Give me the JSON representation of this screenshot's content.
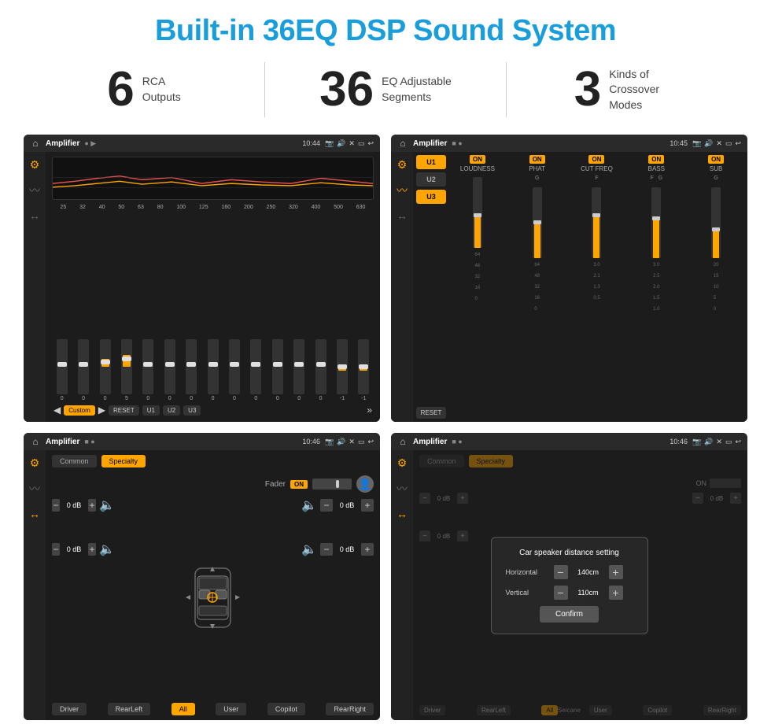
{
  "title": "Built-in 36EQ DSP Sound System",
  "stats": [
    {
      "number": "6",
      "text_line1": "RCA",
      "text_line2": "Outputs"
    },
    {
      "number": "36",
      "text_line1": "EQ Adjustable",
      "text_line2": "Segments"
    },
    {
      "number": "3",
      "text_line1": "Kinds of",
      "text_line2": "Crossover Modes"
    }
  ],
  "screens": [
    {
      "id": "screen1",
      "app_title": "Amplifier",
      "time": "10:44",
      "type": "eq",
      "freq_labels": [
        "25",
        "32",
        "40",
        "50",
        "63",
        "80",
        "100",
        "125",
        "160",
        "200",
        "250",
        "320",
        "400",
        "500",
        "630"
      ],
      "sliders": [
        {
          "pos": 50,
          "val": "0"
        },
        {
          "pos": 50,
          "val": "0"
        },
        {
          "pos": 45,
          "val": "0"
        },
        {
          "pos": 52,
          "val": "5"
        },
        {
          "pos": 50,
          "val": "0"
        },
        {
          "pos": 50,
          "val": "0"
        },
        {
          "pos": 50,
          "val": "0"
        },
        {
          "pos": 50,
          "val": "0"
        },
        {
          "pos": 50,
          "val": "0"
        },
        {
          "pos": 50,
          "val": "0"
        },
        {
          "pos": 50,
          "val": "0"
        },
        {
          "pos": 50,
          "val": "0"
        },
        {
          "pos": 50,
          "val": "0"
        },
        {
          "pos": 52,
          "val": "-1"
        },
        {
          "pos": 52,
          "val": "-1"
        }
      ],
      "preset_label": "Custom",
      "buttons": [
        "RESET",
        "U1",
        "U2",
        "U3"
      ]
    },
    {
      "id": "screen2",
      "app_title": "Amplifier",
      "time": "10:45",
      "type": "crossover",
      "u_buttons": [
        "U1",
        "U2",
        "U3"
      ],
      "channels": [
        "LOUDNESS",
        "PHAT",
        "CUT FREQ",
        "BASS",
        "SUB"
      ],
      "channel_on": [
        true,
        true,
        true,
        true,
        true
      ]
    },
    {
      "id": "screen3",
      "app_title": "Amplifier",
      "time": "10:46",
      "type": "fader",
      "tabs": [
        "Common",
        "Specialty"
      ],
      "fader_label": "Fader",
      "on_label": "ON",
      "speaker_values": [
        "0 dB",
        "0 dB",
        "0 dB",
        "0 dB"
      ],
      "bottom_buttons": [
        "Driver",
        "RearLeft",
        "All",
        "User",
        "Copilot",
        "RearRight"
      ]
    },
    {
      "id": "screen4",
      "app_title": "Amplifier",
      "time": "10:46",
      "type": "distance",
      "tabs": [
        "Common",
        "Specialty"
      ],
      "dialog_title": "Car speaker distance setting",
      "horizontal_label": "Horizontal",
      "horizontal_value": "140cm",
      "vertical_label": "Vertical",
      "vertical_value": "110cm",
      "confirm_label": "Confirm",
      "on_label": "ON",
      "bottom_buttons": [
        "Driver",
        "RearLeft",
        "All",
        "User",
        "Copilot",
        "RearRight"
      ]
    }
  ]
}
